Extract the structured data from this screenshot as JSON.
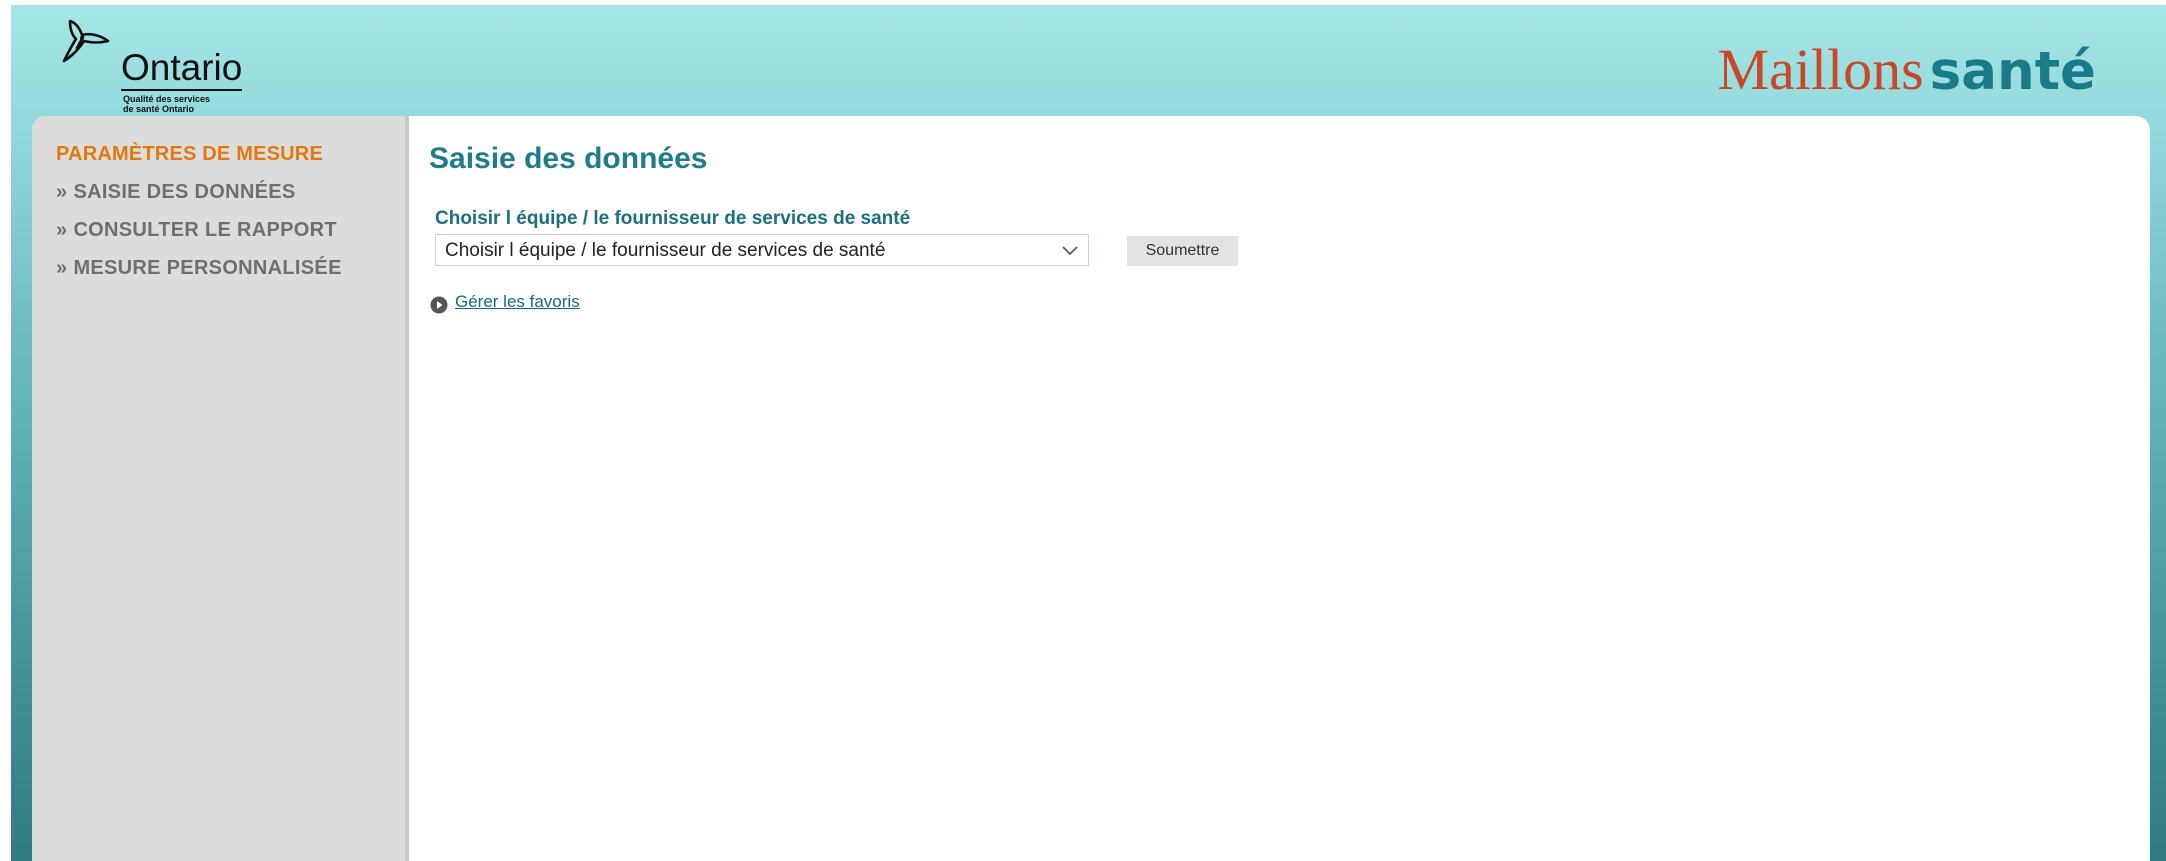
{
  "header": {
    "ontario_logo_text": "Ontario",
    "ontario_subtitle_line1": "Qualité des services",
    "ontario_subtitle_line2": "de santé Ontario",
    "brand_part1": "Maillons",
    "brand_part2": "santé"
  },
  "sidebar": {
    "heading": "PARAMÈTRES DE MESURE",
    "bullet": "»",
    "items": [
      {
        "label": "SAISIE DES DONNÉES"
      },
      {
        "label": "CONSULTER LE RAPPORT"
      },
      {
        "label": "MESURE PERSONNALISÉE"
      }
    ]
  },
  "main": {
    "title": "Saisie des données",
    "field_label": "Choisir l équipe / le fournisseur de services de santé",
    "select_value": "Choisir l équipe / le fournisseur de services de santé",
    "submit_label": "Soumettre",
    "favorites_link": "Gérer les favoris"
  },
  "colors": {
    "sidebar_heading": "#e07a10",
    "title": "#1e7c8c",
    "brand_red": "#c8492a",
    "brand_teal": "#1b7a88"
  }
}
